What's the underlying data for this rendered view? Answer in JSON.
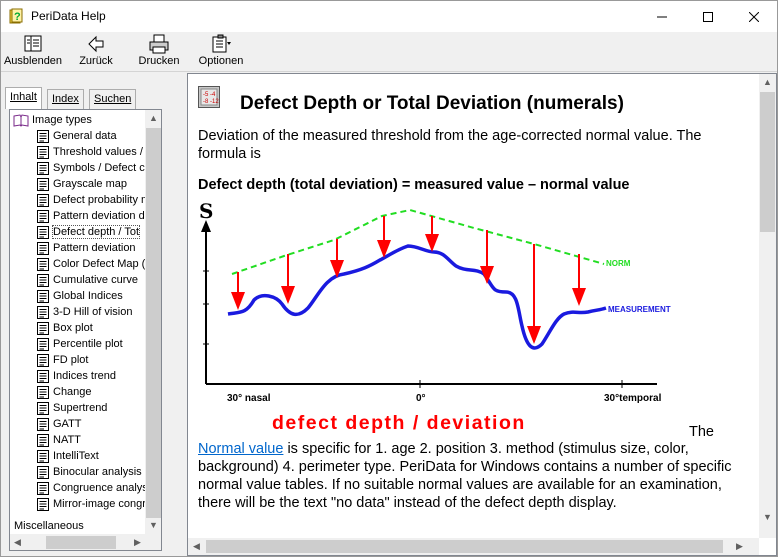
{
  "window": {
    "title": "PeriData Help"
  },
  "toolbar": {
    "hide_label": "Ausblenden",
    "back_label": "Zurück",
    "print_label": "Drucken",
    "options_label": "Optionen"
  },
  "nav": {
    "tabs": [
      {
        "label": "Inhalt"
      },
      {
        "label": "Index"
      },
      {
        "label": "Suchen"
      }
    ],
    "root": "Image types",
    "items": [
      "General data",
      "Threshold values /",
      "Symbols / Defect c",
      "Grayscale map",
      "Defect probability m",
      "Pattern deviation d",
      "Defect depth / Tot",
      "Pattern deviation",
      "Color Defect Map (",
      "Cumulative curve",
      "Global Indices",
      "3-D Hill of vision",
      "Box plot",
      "Percentile plot",
      "FD plot",
      "Indices trend",
      "Change",
      "Supertrend",
      "GATT",
      "NATT",
      "IntelliText",
      "Binocular analysis",
      "Congruence analys",
      "Mirror-image congr"
    ],
    "selected_index": 6,
    "bottom": "Miscellaneous"
  },
  "content": {
    "title": "Defect Depth or Total Deviation (numerals)",
    "intro": "Deviation of the measured threshold from the age-corrected normal value. The formula is",
    "formula": "Defect depth (total deviation) = measured value – normal value",
    "caption": "defect  depth  /  deviation",
    "body_the": "The",
    "link": "Normal value",
    "body": " is specific for 1. age 2. position 3. method (stimulus size, color, background) 4. perimeter type. PeriData for Windows contains a number of specific normal value tables. If no suitable normal values are available for an examination, there will be the text \"no data\" instead of the defect depth display."
  },
  "diagram": {
    "y_axis_label": "S",
    "norm_label": "NORM",
    "measurement_label": "MEASUREMENT",
    "x_labels": [
      "30° nasal",
      "0°",
      "30°temporal"
    ],
    "colors": {
      "norm": "#22dd22",
      "measurement": "#1a1adf",
      "arrows": "#ff0000"
    }
  },
  "icon_names": [
    "help-book-icon",
    "hide-icon",
    "back-arrow-icon",
    "printer-icon",
    "options-icon",
    "minimize-icon",
    "maximize-icon",
    "close-icon",
    "document-icon",
    "open-book-icon",
    "topic-numerals-icon"
  ]
}
